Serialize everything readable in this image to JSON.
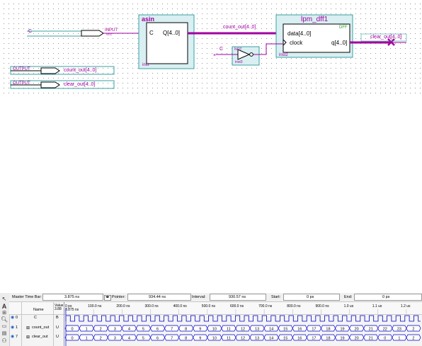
{
  "schematic": {
    "input_signal": "C",
    "input_type": "INPUT",
    "input_vcc": "VCC",
    "asin_name": "asin",
    "asin_in": "C",
    "asin_out": "Q[4..0]",
    "asin_inst": "inst",
    "wire_count": "count_out[4..0]",
    "not_input": "C",
    "not_label": "NOT",
    "not_inst": "inst3",
    "lpm_name": "lpm_dff1",
    "lpm_tag": "DFF",
    "lpm_data": "data[4..0]",
    "lpm_clock": "clock",
    "lpm_q": "q[4..0]",
    "lpm_inst": "inst2",
    "out_wire": "clear_out[4..0]",
    "out1_type": "OUTPUT",
    "out1_name": "count_out[4..0]",
    "out2_type": "OUTPUT",
    "out2_name": "clear_out[4..0]"
  },
  "waveform": {
    "master_label": "Master Time Bar:",
    "master_value": "3.875 ns",
    "pointer_label": "Pointer:",
    "pointer_value": "934.44 ns",
    "interval_label": "Interval:",
    "interval_value": "930.57 ns",
    "start_label": "Start:",
    "start_value": "0 ps",
    "end_label": "End:",
    "end_value": "0 ps",
    "col_name": "Name",
    "col_value": "Value\n3.88",
    "marker": "3.875 ns",
    "time_ticks": [
      "0 ps",
      "100.0 ns",
      "200.0 ns",
      "300.0 ns",
      "400.0 ns",
      "500.0 ns",
      "600.0 ns",
      "700.0 ns",
      "800.0 ns",
      "900.0 ns",
      "1.0 us",
      "1.1 us",
      "1.2 us"
    ],
    "rows": [
      {
        "idx": "0",
        "name": "C",
        "value": "B"
      },
      {
        "idx": "1",
        "name": "count_out",
        "value": "U"
      },
      {
        "idx": "7",
        "name": "clear_out",
        "value": "U"
      }
    ],
    "count_values": [
      "0",
      "1",
      "2",
      "3",
      "4",
      "5",
      "6",
      "7",
      "8",
      "9",
      "10",
      "11",
      "12",
      "13",
      "14",
      "15",
      "16",
      "17",
      "18",
      "19",
      "20",
      "21",
      "22",
      "23",
      "2"
    ],
    "clear_values": [
      "0",
      "1",
      "2",
      "3",
      "4",
      "5",
      "6",
      "7",
      "8",
      "9",
      "10",
      "11",
      "12",
      "13",
      "14",
      "15",
      "16",
      "17",
      "18",
      "19",
      "20",
      "21",
      "0",
      "1",
      "2"
    ],
    "colors": {
      "signal": "#0000c8",
      "bus_bg": "#ffffff"
    }
  }
}
